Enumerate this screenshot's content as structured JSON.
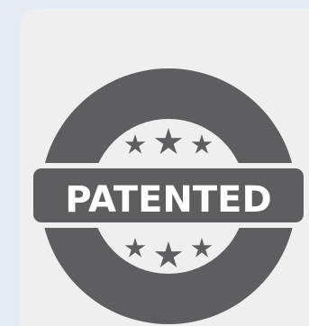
{
  "badge": {
    "text": "PATENTED",
    "colors": {
      "ring": "#5e5e60",
      "inner": "#efefef",
      "band": "#5e5e60",
      "band_text": "#ffffff",
      "card": "#efefef",
      "background": "#e6ebf3"
    },
    "icons": {
      "top_stars": [
        "star-icon",
        "star-icon",
        "star-icon"
      ],
      "bottom_stars": [
        "star-icon",
        "star-icon",
        "star-icon"
      ]
    }
  }
}
